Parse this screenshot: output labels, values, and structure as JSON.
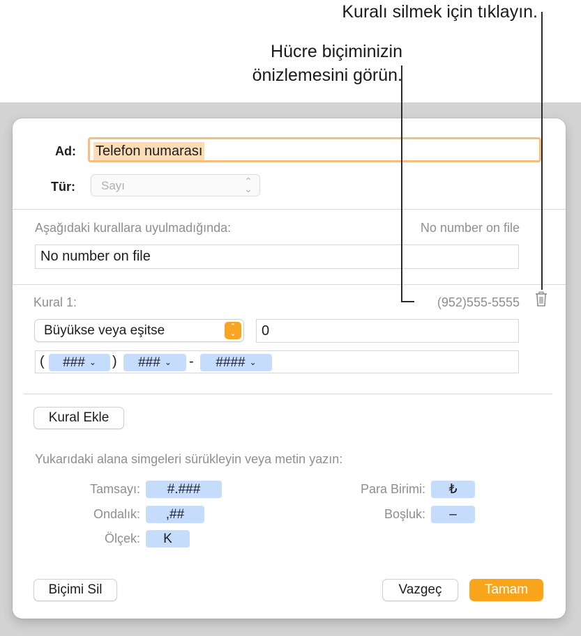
{
  "callouts": {
    "delete_rule": "Kuralı silmek için tıklayın.",
    "preview_line1": "Hücre biçiminizin",
    "preview_line2": "önizlemesini görün."
  },
  "dialog": {
    "name_label": "Ad:",
    "name_value": "Telefon numarası",
    "type_label": "Tür:",
    "type_value": "Sayı",
    "fallback_label": "Aşağıdaki kurallara uyulmadığında:",
    "fallback_preview": "No number on file",
    "fallback_value": "No number on file",
    "rule": {
      "title": "Kural 1:",
      "preview": "(952)555-5555",
      "condition": "Büyükse veya eşitse",
      "condition_value": "0",
      "format_tokens": [
        {
          "kind": "text",
          "value": "("
        },
        {
          "kind": "token",
          "value": "###"
        },
        {
          "kind": "text",
          "value": ")"
        },
        {
          "kind": "token",
          "value": "###"
        },
        {
          "kind": "text",
          "value": "-"
        },
        {
          "kind": "token",
          "value": "####"
        }
      ]
    },
    "add_rule_button": "Kural Ekle",
    "drag_hint": "Yukarıdaki alana simgeleri sürükleyin veya metin yazın:",
    "symbols": {
      "integer_label": "Tamsayı:",
      "integer_token": "#.###",
      "decimal_label": "Ondalık:",
      "decimal_token": ",##",
      "scale_label": "Ölçek:",
      "scale_token": "K",
      "currency_label": "Para Birimi:",
      "currency_token": "₺",
      "space_label": "Boşluk:",
      "space_token": "–"
    },
    "buttons": {
      "clear_format": "Biçimi Sil",
      "cancel": "Vazgeç",
      "ok": "Tamam"
    }
  },
  "colors": {
    "accent": "#f8a51b",
    "token_fill": "#c5dcfc",
    "name_focus": "#f6be7e"
  }
}
